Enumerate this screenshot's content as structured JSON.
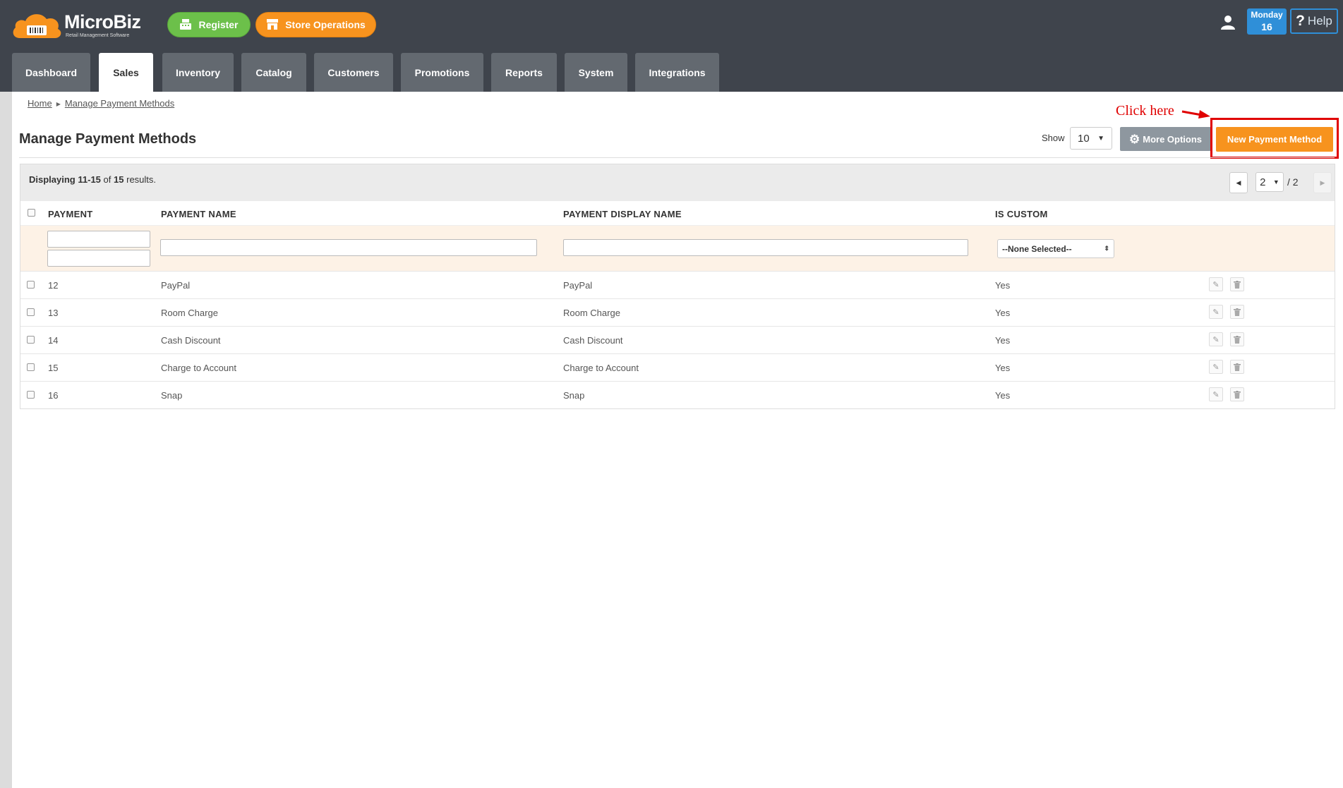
{
  "app": {
    "brand": "MicroBiz",
    "tagline": "Retail Management Software",
    "register_label": "Register",
    "store_ops_label": "Store Operations",
    "date_day": "Monday",
    "date_num": "16",
    "help_label": "Help"
  },
  "tabs": [
    {
      "label": "Dashboard"
    },
    {
      "label": "Sales"
    },
    {
      "label": "Inventory"
    },
    {
      "label": "Catalog"
    },
    {
      "label": "Customers"
    },
    {
      "label": "Promotions"
    },
    {
      "label": "Reports"
    },
    {
      "label": "System"
    },
    {
      "label": "Integrations"
    }
  ],
  "active_tab": "Sales",
  "breadcrumb": {
    "home": "Home",
    "current": "Manage Payment Methods"
  },
  "page": {
    "title": "Manage Payment Methods",
    "show_label": "Show",
    "show_value": "10",
    "more_options_label": "More Options",
    "new_button_label": "New Payment Method",
    "annotation": "Click here"
  },
  "grid": {
    "displaying_prefix": "Displaying",
    "displaying_range": "11-15",
    "displaying_of": "of",
    "displaying_total": "15",
    "displaying_suffix": "results.",
    "page_current": "2",
    "page_total": "/ 2",
    "columns": [
      "PAYMENT",
      "PAYMENT NAME",
      "PAYMENT DISPLAY NAME",
      "IS CUSTOM"
    ],
    "filter_select": "--None Selected--",
    "rows": [
      {
        "id": "12",
        "name": "PayPal",
        "display": "PayPal",
        "custom": "Yes"
      },
      {
        "id": "13",
        "name": "Room Charge",
        "display": "Room Charge",
        "custom": "Yes"
      },
      {
        "id": "14",
        "name": "Cash Discount",
        "display": "Cash Discount",
        "custom": "Yes"
      },
      {
        "id": "15",
        "name": "Charge to Account",
        "display": "Charge to Account",
        "custom": "Yes"
      },
      {
        "id": "16",
        "name": "Snap",
        "display": "Snap",
        "custom": "Yes"
      }
    ]
  },
  "colors": {
    "topbar": "#3f444c",
    "tab": "#636970",
    "register_green": "#6cc04a",
    "orange": "#f7931e",
    "blue": "#2f8fd8",
    "annotation_red": "#e00000",
    "filter_row": "#fdf2e6"
  }
}
